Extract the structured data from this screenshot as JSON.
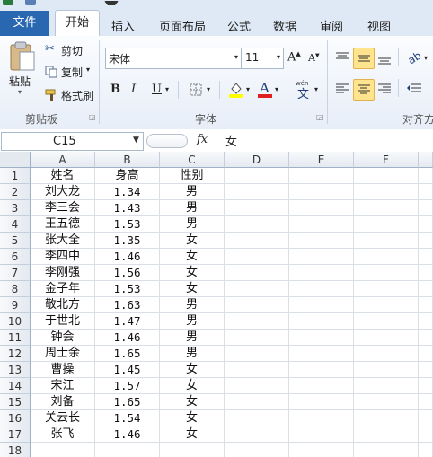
{
  "ribbon": {
    "tabs": [
      "文件",
      "开始",
      "插入",
      "页面布局",
      "公式",
      "数据",
      "审阅",
      "视图"
    ],
    "clipboard": {
      "paste": "粘贴",
      "cut": "剪切",
      "copy": "复制",
      "format_painter": "格式刷",
      "group_label": "剪贴板"
    },
    "font": {
      "font_name": "宋体",
      "font_size": "11",
      "bold": "B",
      "italic": "I",
      "underline": "U",
      "group_label": "字体"
    },
    "alignment": {
      "group_label": "对齐方"
    }
  },
  "formula_bar": {
    "name_box": "C15",
    "fx": "fx",
    "value": "女"
  },
  "sheet": {
    "columns": [
      "A",
      "B",
      "C",
      "D",
      "E",
      "F"
    ],
    "row_numbers": [
      "1",
      "2",
      "3",
      "4",
      "5",
      "6",
      "7",
      "8",
      "9",
      "10",
      "11",
      "12",
      "13",
      "14",
      "15",
      "16",
      "17",
      "18"
    ],
    "rows": [
      [
        "姓名",
        "身高",
        "性别"
      ],
      [
        "刘大龙",
        "1.34",
        "男"
      ],
      [
        "李三会",
        "1.43",
        "男"
      ],
      [
        "王五德",
        "1.53",
        "男"
      ],
      [
        "张大全",
        "1.35",
        "女"
      ],
      [
        "李四中",
        "1.46",
        "女"
      ],
      [
        "李刚强",
        "1.56",
        "女"
      ],
      [
        "金子年",
        "1.53",
        "女"
      ],
      [
        "敬北方",
        "1.63",
        "男"
      ],
      [
        "于世北",
        "1.47",
        "男"
      ],
      [
        "钟会",
        "1.46",
        "男"
      ],
      [
        "周士余",
        "1.65",
        "男"
      ],
      [
        "曹操",
        "1.45",
        "女"
      ],
      [
        "宋江",
        "1.57",
        "女"
      ],
      [
        "刘备",
        "1.65",
        "女"
      ],
      [
        "关云长",
        "1.54",
        "女"
      ],
      [
        "张飞",
        "1.46",
        "女"
      ],
      [
        "",
        "",
        ""
      ]
    ]
  },
  "colors": {
    "file_tab": "#2a67b1",
    "ribbon_bg": "#dfe9f5",
    "highlight": "#ffe38d",
    "font_color_red": "#e02020",
    "fill_yellow": "#ffff00"
  }
}
